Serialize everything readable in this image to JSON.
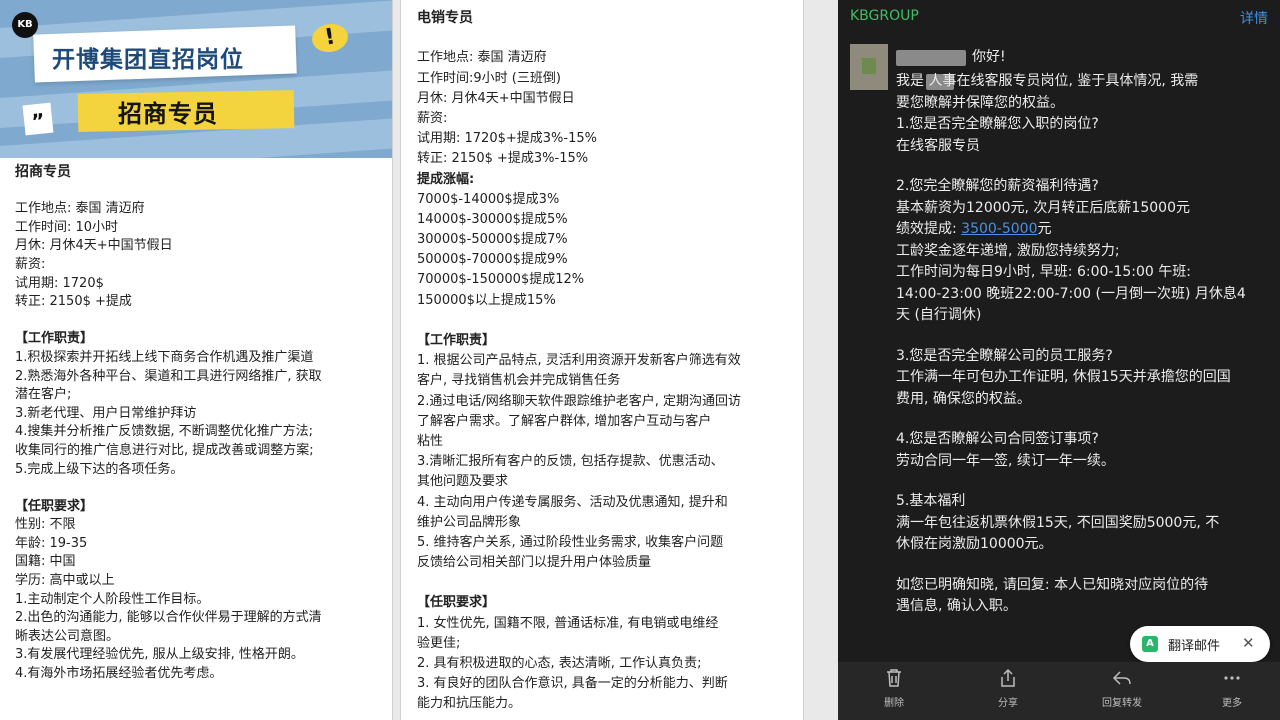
{
  "p1": {
    "banner": {
      "logo": "KB",
      "headline": "开博集团直招岗位",
      "subheadline": "招商专员",
      "quote_mark": "”",
      "exclaim": "!"
    },
    "lines": [
      {
        "t": "招商专员",
        "style": "bigt"
      },
      {
        "t": "",
        "style": "gap"
      },
      {
        "t": "工作地点: 泰国 清迈府"
      },
      {
        "t": "工作时间:  10小时"
      },
      {
        "t": "月休: 月休4天+中国节假日"
      },
      {
        "t": "薪资:"
      },
      {
        "t": "试用期: 1720$"
      },
      {
        "t": "转正: 2150$ +提成"
      },
      {
        "t": "",
        "style": "gap"
      },
      {
        "t": "【工作职责】",
        "style": "bold"
      },
      {
        "t": "1.积极探索并开拓线上线下商务合作机遇及推广渠道"
      },
      {
        "t": "2.熟悉海外各种平台、渠道和工具进行网络推广, 获取"
      },
      {
        "t": "潜在客户;"
      },
      {
        "t": "3.新老代理、用户日常维护拜访"
      },
      {
        "t": "4.搜集并分析推广反馈数据, 不断调整优化推广方法;"
      },
      {
        "t": "收集同行的推广信息进行对比, 提成改善或调整方案;"
      },
      {
        "t": "5.完成上级下达的各项任务。"
      },
      {
        "t": "",
        "style": "gap"
      },
      {
        "t": "【任职要求】",
        "style": "bold"
      },
      {
        "t": "性别: 不限"
      },
      {
        "t": "年龄: 19-35"
      },
      {
        "t": "国籍: 中国"
      },
      {
        "t": "学历: 高中或以上"
      },
      {
        "t": "1.主动制定个人阶段性工作目标。"
      },
      {
        "t": "2.出色的沟通能力, 能够以合作伙伴易于理解的方式清"
      },
      {
        "t": "晰表达公司意图。"
      },
      {
        "t": "3.有发展代理经验优先, 服从上级安排, 性格开朗。"
      },
      {
        "t": "4.有海外市场拓展经验者优先考虑。"
      }
    ]
  },
  "p2": {
    "lines": [
      {
        "t": "电销专员",
        "style": "bigt"
      },
      {
        "t": "",
        "style": "gap"
      },
      {
        "t": "工作地点: 泰国 清迈府"
      },
      {
        "t": "工作时间:9小时 (三班倒)"
      },
      {
        "t": "月休: 月休4天+中国节假日"
      },
      {
        "t": "薪资:"
      },
      {
        "t": "试用期: 1720$+提成3%-15%"
      },
      {
        "t": "转正: 2150$ +提成3%-15%"
      },
      {
        "t": "提成涨幅:",
        "style": "bold"
      },
      {
        "t": "7000$-14000$提成3%"
      },
      {
        "t": "14000$-30000$提成5%"
      },
      {
        "t": "30000$-50000$提成7%"
      },
      {
        "t": "50000$-70000$提成9%"
      },
      {
        "t": "70000$-150000$提成12%"
      },
      {
        "t": "150000$以上提成15%"
      },
      {
        "t": "",
        "style": "gap"
      },
      {
        "t": "【工作职责】",
        "style": "bold"
      },
      {
        "t": "1. 根据公司产品特点, 灵活利用资源开发新客户筛选有效"
      },
      {
        "t": "客户, 寻找销售机会并完成销售任务"
      },
      {
        "t": "2.通过电话/网络聊天软件跟踪维护老客户, 定期沟通回访"
      },
      {
        "t": "了解客户需求。了解客户群体, 增加客户互动与客户"
      },
      {
        "t": "粘性"
      },
      {
        "t": "3.清晰汇报所有客户的反馈, 包括存提款、优惠活动、"
      },
      {
        "t": "其他问题及要求"
      },
      {
        "t": "4. 主动向用户传递专属服务、活动及优惠通知, 提升和"
      },
      {
        "t": "维护公司品牌形象"
      },
      {
        "t": "5. 维持客户关系, 通过阶段性业务需求, 收集客户问题"
      },
      {
        "t": "反馈给公司相关部门以提升用户体验质量"
      },
      {
        "t": "",
        "style": "gap"
      },
      {
        "t": "【任职要求】",
        "style": "bold"
      },
      {
        "t": "1. 女性优先, 国籍不限, 普通话标准, 有电销或电维经"
      },
      {
        "t": "验更佳;"
      },
      {
        "t": "2. 具有积极进取的心态, 表达清晰, 工作认真负责;"
      },
      {
        "t": "3. 有良好的团队合作意识, 具备一定的分析能力、判断"
      },
      {
        "t": "能力和抗压能力。"
      }
    ]
  },
  "p3": {
    "from": "KBGROUP",
    "detail": "详情",
    "greeting": "你好!",
    "body": [
      {
        "t": "我是      人事在线客服专员岗位, 鉴于具体情况, 我需"
      },
      {
        "t": "要您瞭解并保障您的权益。"
      },
      {
        "t": "1.您是否完全瞭解您入职的岗位?"
      },
      {
        "t": "在线客服专员"
      },
      {
        "t": "",
        "style": "gap"
      },
      {
        "t": "2.您完全瞭解您的薪资福利待遇?"
      },
      {
        "t": "基本薪资为12000元, 次月转正后底薪15000元"
      },
      {
        "t": "绩效提成: ",
        "link": "3500-5000",
        "after": "元"
      },
      {
        "t": "工龄奖金逐年递增, 激励您持续努力;"
      },
      {
        "t": "工作时间为每日9小时, 早班: 6:00-15:00 午班:"
      },
      {
        "t": "14:00-23:00 晚班22:00-7:00 (一月倒一次班) 月休息4"
      },
      {
        "t": "天 (自行调休)"
      },
      {
        "t": "",
        "style": "gap"
      },
      {
        "t": "3.您是否完全瞭解公司的员工服务?"
      },
      {
        "t": "工作满一年可包办工作证明, 休假15天并承擔您的回国"
      },
      {
        "t": "费用, 确保您的权益。"
      },
      {
        "t": "",
        "style": "gap"
      },
      {
        "t": "4.您是否瞭解公司合同签订事项?"
      },
      {
        "t": "劳动合同一年一签, 续订一年一续。"
      },
      {
        "t": "",
        "style": "gap"
      },
      {
        "t": "5.基本福利"
      },
      {
        "t": "满一年包往返机票休假15天, 不回国奖励5000元, 不"
      },
      {
        "t": "休假在岗激励10000元。"
      },
      {
        "t": "",
        "style": "gap"
      },
      {
        "t": "如您已明确知晓, 请回复: 本人已知晓对应岗位的待"
      },
      {
        "t": "遇信息, 确认入职。"
      }
    ],
    "translate_label": "翻译邮件",
    "toolbar": {
      "delete": "删除",
      "share": "分享",
      "reply": "回复转发",
      "more": "更多"
    }
  }
}
